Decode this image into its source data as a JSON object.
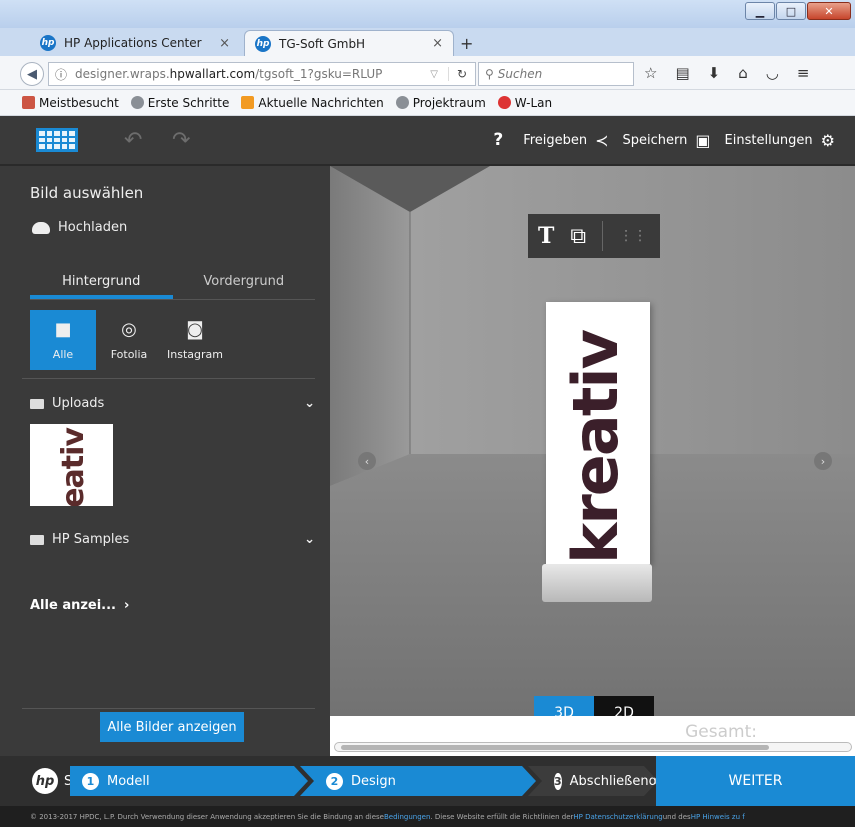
{
  "browser": {
    "tabs": [
      {
        "label": "HP Applications Center",
        "favicon": "hp"
      },
      {
        "label": "TG-Soft GmbH",
        "favicon": "hp"
      }
    ],
    "url_prefix": "designer.wraps.",
    "url_host": "hpwallart.com",
    "url_path": "/tgsoft_1?gsku=RLUP",
    "search_placeholder": "Suchen",
    "bookmarks": [
      "Meistbesucht",
      "Erste Schritte",
      "Aktuelle Nachrichten",
      "Projektraum",
      "W-Lan"
    ]
  },
  "app_toolbar": {
    "help": "?",
    "share_label": "Freigeben",
    "save_label": "Speichern",
    "settings_label": "Einstellungen"
  },
  "sidebar": {
    "title": "Bild auswählen",
    "upload_label": "Hochladen",
    "tabs": [
      "Hintergrund",
      "Vordergrund"
    ],
    "sources": [
      "Alle",
      "Fotolia",
      "Instagram"
    ],
    "uploads_label": "Uploads",
    "uploads_thumb_text": "kreativ",
    "samples_label": "HP Samples",
    "show_all_short": "Alle anzei...",
    "show_all_button": "Alle Bilder anzeigen"
  },
  "viewport": {
    "banner_text": "kreativ",
    "mode_3d": "3D",
    "mode_2d": "2D",
    "total_label": "Gesamt:"
  },
  "steps": [
    {
      "num": "1",
      "label": "Modell"
    },
    {
      "num": "2",
      "label": "Design"
    },
    {
      "num": "3",
      "label": "Abschließende"
    }
  ],
  "steps_prefix": "S",
  "next_button": "WEITER",
  "footer": {
    "text_a": "© 2013-2017 HPDC, L.P. Durch Verwendung dieser Anwendung akzeptieren Sie die Bindung an diese ",
    "link_a": "Bedingungen",
    "text_b": ". Diese Website erfüllt die Richtlinien der ",
    "link_b": "HP Datenschutzerklärung",
    "text_c": " und des ",
    "link_c": "HP Hinweis zu f"
  },
  "colors": {
    "accent": "#1a8ad4",
    "panel": "#3a3a3a"
  }
}
